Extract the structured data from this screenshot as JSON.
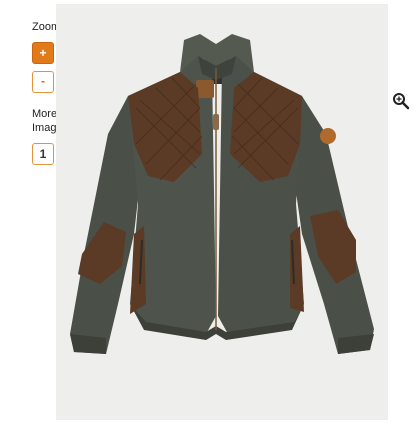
{
  "sidebar": {
    "zoom_label": "Zoom",
    "zoom_in_label": "+",
    "zoom_out_label": "-",
    "more_images_label": "More Images",
    "thumbnails": [
      "1"
    ]
  },
  "product_image": {
    "icon": "jacket-image"
  },
  "controls": {
    "magnifier_icon": "magnifier-icon"
  },
  "colors": {
    "accent": "#e07a1b",
    "fleece": "#4a4f47",
    "suede": "#5b3a26"
  }
}
